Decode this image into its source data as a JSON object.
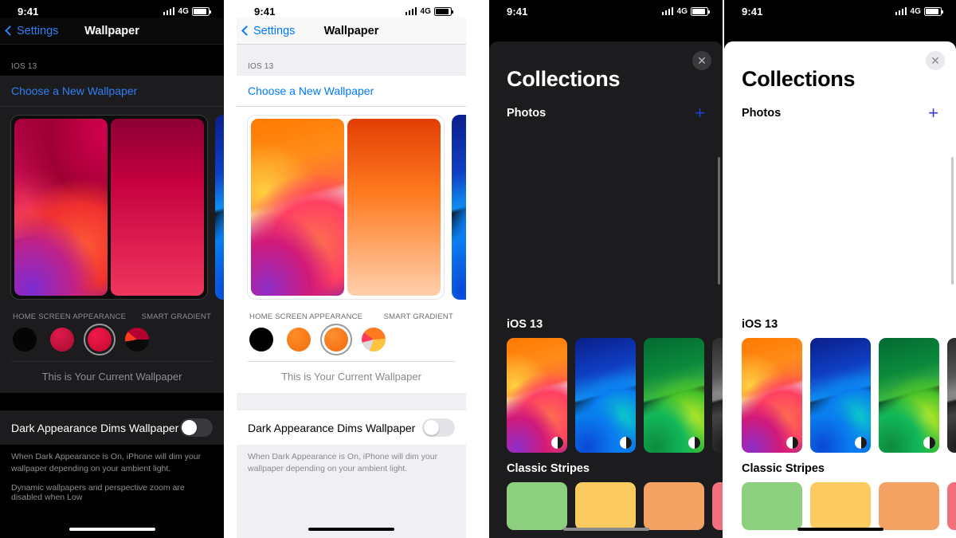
{
  "status_bar": {
    "time": "9:41",
    "network": "4G",
    "signal_icon": "signal-bars-icon",
    "battery_icon": "battery-icon"
  },
  "panels": [
    {
      "id": "wallpaper-settings-dark",
      "theme": "dark",
      "nav": {
        "back_label": "Settings",
        "title": "Wallpaper",
        "back_icon": "chevron-left-icon"
      },
      "group_header": "IOS 13",
      "choose_link": "Choose a New Wallpaper",
      "appearance_label": "HOME SCREEN APPEARANCE",
      "gradient_label": "SMART GRADIENT",
      "swatches": [
        {
          "name": "black",
          "color": "#050505"
        },
        {
          "name": "dark-red",
          "color": "#c5113f"
        },
        {
          "name": "red-selected",
          "color": "#e01243",
          "selected": true
        },
        {
          "name": "split-gradient",
          "color": "#ff3b2f"
        }
      ],
      "current_wallpaper_label": "This is Your Current Wallpaper",
      "toggle_label": "Dark Appearance Dims Wallpaper",
      "toggle_state": "off",
      "footer": "When Dark Appearance is On, iPhone will dim your wallpaper depending on your ambient light.",
      "footer_cut": "Dynamic wallpapers and perspective zoom are disabled when Low"
    },
    {
      "id": "wallpaper-settings-light",
      "theme": "light",
      "nav": {
        "back_label": "Settings",
        "title": "Wallpaper",
        "back_icon": "chevron-left-icon"
      },
      "group_header": "IOS 13",
      "choose_link": "Choose a New Wallpaper",
      "appearance_label": "HOME SCREEN APPEARANCE",
      "gradient_label": "SMART GRADIENT",
      "swatches": [
        {
          "name": "black",
          "color": "#000000"
        },
        {
          "name": "orange",
          "color": "#f97316"
        },
        {
          "name": "orange-selected",
          "color": "#f97316",
          "selected": true
        },
        {
          "name": "split-gradient",
          "color": "#ff8c1a"
        }
      ],
      "current_wallpaper_label": "This is Your Current Wallpaper",
      "toggle_label": "Dark Appearance Dims Wallpaper",
      "toggle_state": "off",
      "footer": "When Dark Appearance is On, iPhone will dim your wallpaper depending on your ambient light."
    },
    {
      "id": "collections-dark",
      "theme": "dark",
      "close_icon": "close-icon",
      "title": "Collections",
      "photos_label": "Photos",
      "add_icon": "plus-icon",
      "sections": [
        {
          "title": "iOS 13",
          "items": [
            "orange-red-wave",
            "blue-wave",
            "green-wave",
            "grey-wave"
          ]
        },
        {
          "title": "Classic Stripes",
          "items": [
            "green-stripe",
            "yellow-stripe",
            "orange-stripe",
            "pink-stripe"
          ]
        }
      ]
    },
    {
      "id": "collections-light",
      "theme": "light",
      "close_icon": "close-icon",
      "title": "Collections",
      "photos_label": "Photos",
      "add_icon": "plus-icon",
      "sections": [
        {
          "title": "iOS 13",
          "items": [
            "orange-red-wave",
            "blue-wave",
            "green-wave",
            "grey-wave"
          ]
        },
        {
          "title": "Classic Stripes",
          "items": [
            "green-stripe",
            "yellow-stripe",
            "orange-stripe",
            "pink-stripe"
          ]
        }
      ]
    }
  ],
  "colors": {
    "accent_blue": "#007aff",
    "dark_bg": "#000000",
    "dark_card": "#1c1c1e",
    "light_bg": "#efeff4"
  }
}
